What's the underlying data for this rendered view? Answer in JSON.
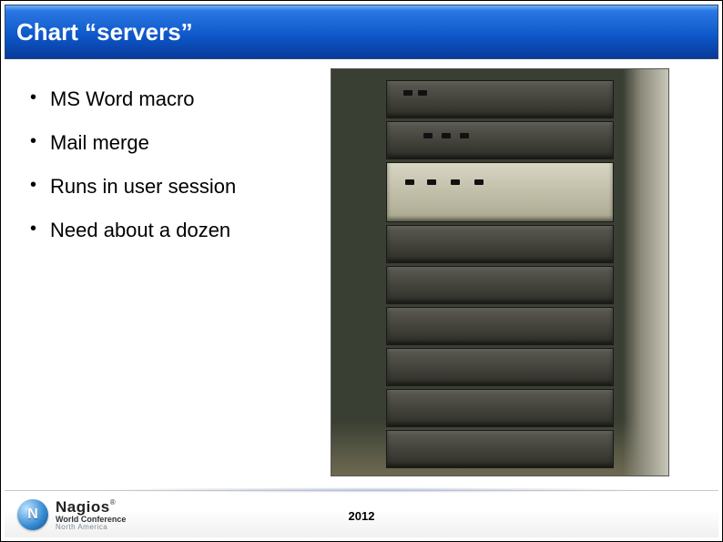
{
  "title": "Chart “servers”",
  "bullets": [
    "MS Word macro",
    "Mail merge",
    "Runs in user session",
    "Need about a dozen"
  ],
  "footer": {
    "brand": "Nagios",
    "reg": "®",
    "line1": "World Conference",
    "line2": "North America",
    "year": "2012"
  }
}
